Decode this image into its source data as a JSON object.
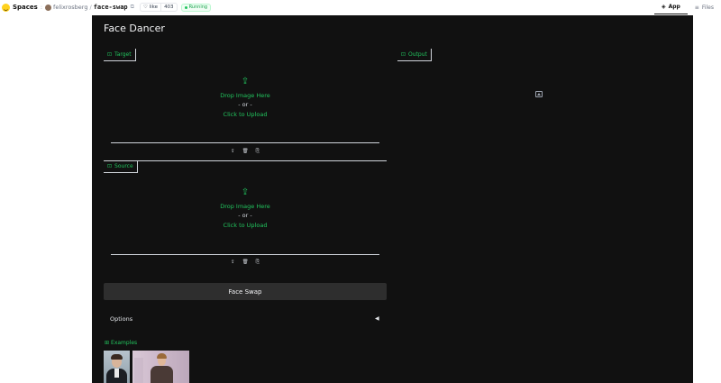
{
  "topbar": {
    "spaces_label": "Spaces",
    "owner": "felixrosberg",
    "repo": "face-swap",
    "like_label": "like",
    "like_count": "403",
    "status": "Running",
    "tabs": [
      {
        "label": "App",
        "icon": "app-icon",
        "active": true
      },
      {
        "label": "Files",
        "icon": "files-icon",
        "active": false
      }
    ]
  },
  "app": {
    "title": "Face Dancer",
    "target": {
      "label": "Target",
      "drop_text": "Drop Image Here",
      "or_text": "- or -",
      "click_text": "Click to Upload"
    },
    "source": {
      "label": "Source",
      "drop_text": "Drop Image Here",
      "or_text": "- or -",
      "click_text": "Click to Upload"
    },
    "output": {
      "label": "Output"
    },
    "swap_button": "Face Swap",
    "options_label": "Options",
    "examples_label": "Examples"
  },
  "colors": {
    "accent": "#22c55e",
    "background": "#111111",
    "button": "#2e2e2e"
  }
}
